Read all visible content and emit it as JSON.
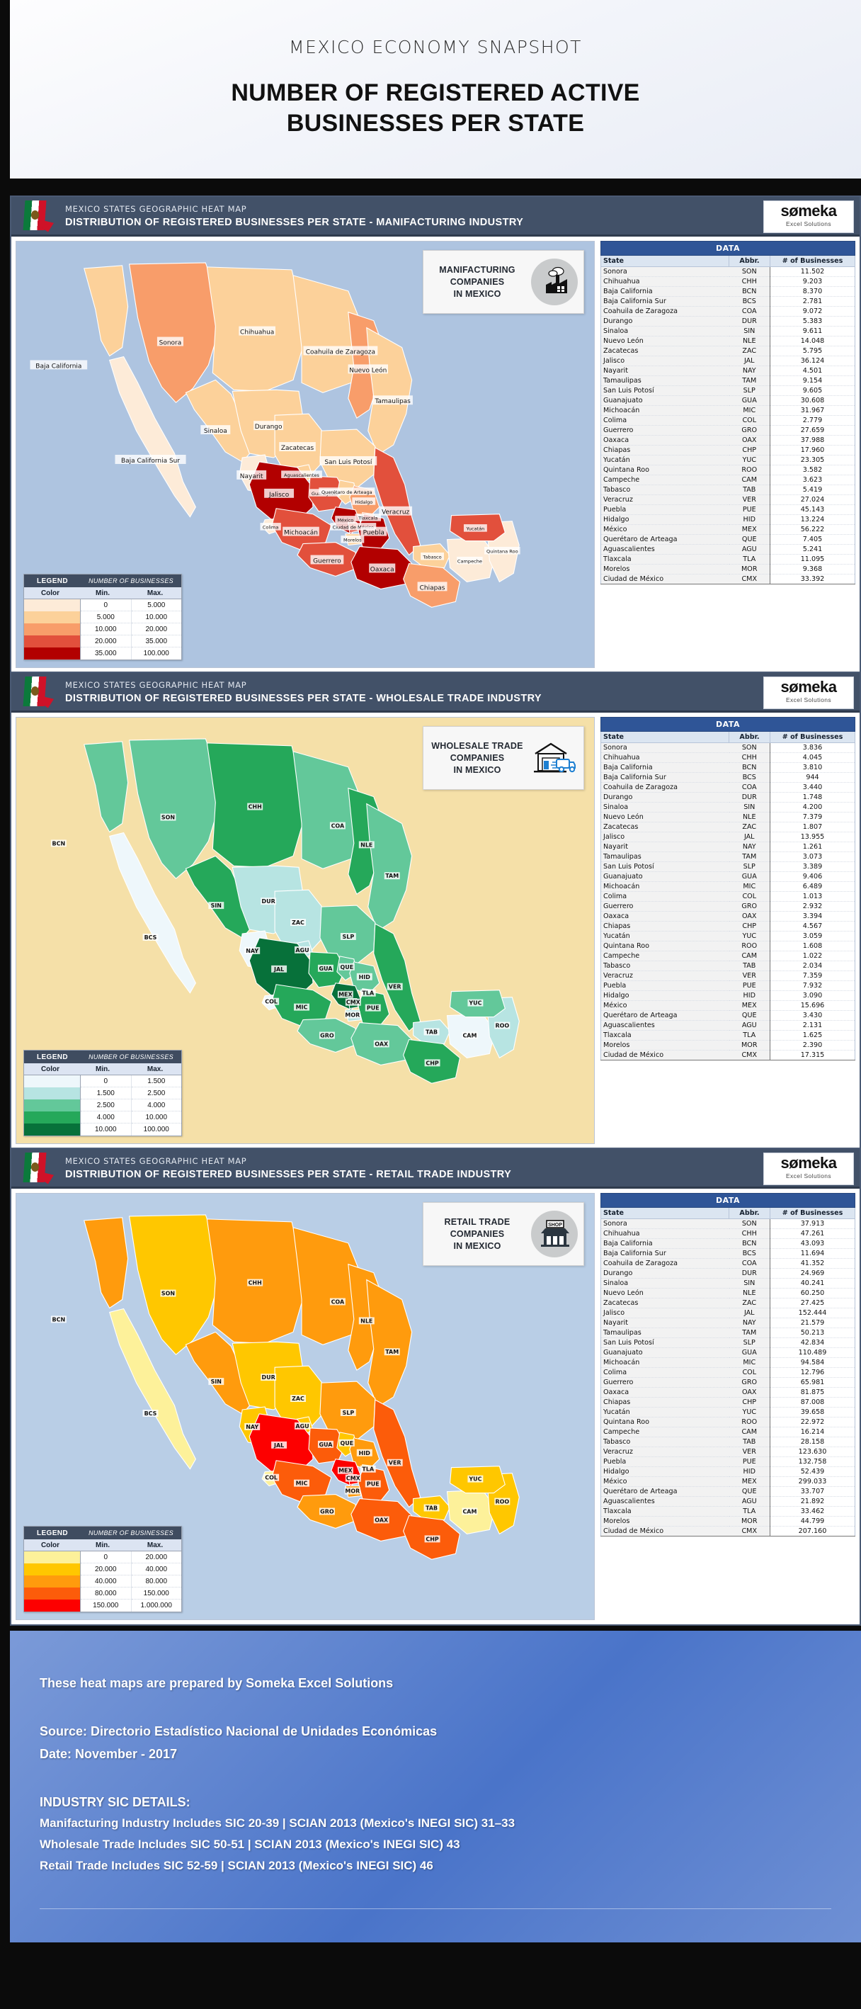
{
  "hero": {
    "subtitle": "MEXICO ECONOMY SNAPSHOT",
    "title_line1": "NUMBER OF REGISTERED ACTIVE",
    "title_line2": "BUSINESSES PER STATE"
  },
  "brand": {
    "name": "sømeka",
    "tagline": "Excel Solutions"
  },
  "table_headers": {
    "banner": "DATA",
    "state": "State",
    "abbr": "Abbr.",
    "number": "# of Businesses"
  },
  "legend_headers": {
    "title": "LEGEND",
    "subtitle": "NUMBER OF BUSINESSES",
    "color": "Color",
    "min": "Min.",
    "max": "Max."
  },
  "panels": [
    {
      "kicker": "MEXICO STATES GEOGRAPHIC HEAT MAP",
      "title": "DISTRIBUTION OF REGISTERED BUSINESSES PER STATE - MANIFACTURING INDUSTRY",
      "map_title": "MANIFACTURING\nCOMPANIES\nIN MEXICO",
      "map_title_lines": [
        "MANIFACTURING",
        "COMPANIES",
        "IN MEXICO"
      ],
      "icon": "factory-icon",
      "sea_color": "#aec4e0",
      "label_mode": "names",
      "legend": [
        {
          "color": "#fdebd8",
          "min": "0",
          "max": "5.000"
        },
        {
          "color": "#fcd19a",
          "min": "5.000",
          "max": "10.000"
        },
        {
          "color": "#f89d6a",
          "min": "10.000",
          "max": "20.000"
        },
        {
          "color": "#e2503c",
          "min": "20.000",
          "max": "35.000"
        },
        {
          "color": "#b20000",
          "min": "35.000",
          "max": "100.000"
        }
      ],
      "rows": [
        {
          "state": "Sonora",
          "abbr": "SON",
          "value": "11.502",
          "n": 11502
        },
        {
          "state": "Chihuahua",
          "abbr": "CHH",
          "value": "9.203",
          "n": 9203
        },
        {
          "state": "Baja California",
          "abbr": "BCN",
          "value": "8.370",
          "n": 8370
        },
        {
          "state": "Baja California Sur",
          "abbr": "BCS",
          "value": "2.781",
          "n": 2781
        },
        {
          "state": "Coahuila de Zaragoza",
          "abbr": "COA",
          "value": "9.072",
          "n": 9072
        },
        {
          "state": "Durango",
          "abbr": "DUR",
          "value": "5.383",
          "n": 5383
        },
        {
          "state": "Sinaloa",
          "abbr": "SIN",
          "value": "9.611",
          "n": 9611
        },
        {
          "state": "Nuevo León",
          "abbr": "NLE",
          "value": "14.048",
          "n": 14048
        },
        {
          "state": "Zacatecas",
          "abbr": "ZAC",
          "value": "5.795",
          "n": 5795
        },
        {
          "state": "Jalisco",
          "abbr": "JAL",
          "value": "36.124",
          "n": 36124
        },
        {
          "state": "Nayarit",
          "abbr": "NAY",
          "value": "4.501",
          "n": 4501
        },
        {
          "state": "Tamaulipas",
          "abbr": "TAM",
          "value": "9.154",
          "n": 9154
        },
        {
          "state": "San Luis Potosí",
          "abbr": "SLP",
          "value": "9.605",
          "n": 9605
        },
        {
          "state": "Guanajuato",
          "abbr": "GUA",
          "value": "30.608",
          "n": 30608
        },
        {
          "state": "Michoacán",
          "abbr": "MIC",
          "value": "31.967",
          "n": 31967
        },
        {
          "state": "Colima",
          "abbr": "COL",
          "value": "2.779",
          "n": 2779
        },
        {
          "state": "Guerrero",
          "abbr": "GRO",
          "value": "27.659",
          "n": 27659
        },
        {
          "state": "Oaxaca",
          "abbr": "OAX",
          "value": "37.988",
          "n": 37988
        },
        {
          "state": "Chiapas",
          "abbr": "CHP",
          "value": "17.960",
          "n": 17960
        },
        {
          "state": "Yucatán",
          "abbr": "YUC",
          "value": "23.305",
          "n": 23305
        },
        {
          "state": "Quintana Roo",
          "abbr": "ROO",
          "value": "3.582",
          "n": 3582
        },
        {
          "state": "Campeche",
          "abbr": "CAM",
          "value": "3.623",
          "n": 3623
        },
        {
          "state": "Tabasco",
          "abbr": "TAB",
          "value": "5.419",
          "n": 5419
        },
        {
          "state": "Veracruz",
          "abbr": "VER",
          "value": "27.024",
          "n": 27024
        },
        {
          "state": "Puebla",
          "abbr": "PUE",
          "value": "45.143",
          "n": 45143
        },
        {
          "state": "Hidalgo",
          "abbr": "HID",
          "value": "13.224",
          "n": 13224
        },
        {
          "state": "México",
          "abbr": "MEX",
          "value": "56.222",
          "n": 56222
        },
        {
          "state": "Querétaro de Arteaga",
          "abbr": "QUE",
          "value": "7.405",
          "n": 7405
        },
        {
          "state": "Aguascalientes",
          "abbr": "AGU",
          "value": "5.241",
          "n": 5241
        },
        {
          "state": "Tlaxcala",
          "abbr": "TLA",
          "value": "11.095",
          "n": 11095
        },
        {
          "state": "Morelos",
          "abbr": "MOR",
          "value": "9.368",
          "n": 9368
        },
        {
          "state": "Ciudad de México",
          "abbr": "CMX",
          "value": "33.392",
          "n": 33392
        }
      ]
    },
    {
      "kicker": "MEXICO STATES GEOGRAPHIC HEAT MAP",
      "title": "DISTRIBUTION OF REGISTERED BUSINESSES PER STATE - WHOLESALE TRADE INDUSTRY",
      "map_title_lines": [
        "WHOLESALE TRADE",
        "COMPANIES",
        "IN MEXICO"
      ],
      "icon": "warehouse-truck-icon",
      "sea_color": "#f5e0a8",
      "label_mode": "abbr",
      "legend": [
        {
          "color": "#eef7fb",
          "min": "0",
          "max": "1.500"
        },
        {
          "color": "#b7e4e2",
          "min": "1.500",
          "max": "2.500"
        },
        {
          "color": "#63c89a",
          "min": "2.500",
          "max": "4.000"
        },
        {
          "color": "#25a85a",
          "min": "4.000",
          "max": "10.000"
        },
        {
          "color": "#07713a",
          "min": "10.000",
          "max": "100.000"
        }
      ],
      "rows": [
        {
          "state": "Sonora",
          "abbr": "SON",
          "value": "3.836",
          "n": 3836
        },
        {
          "state": "Chihuahua",
          "abbr": "CHH",
          "value": "4.045",
          "n": 4045
        },
        {
          "state": "Baja California",
          "abbr": "BCN",
          "value": "3.810",
          "n": 3810
        },
        {
          "state": "Baja California Sur",
          "abbr": "BCS",
          "value": "944",
          "n": 944
        },
        {
          "state": "Coahuila de Zaragoza",
          "abbr": "COA",
          "value": "3.440",
          "n": 3440
        },
        {
          "state": "Durango",
          "abbr": "DUR",
          "value": "1.748",
          "n": 1748
        },
        {
          "state": "Sinaloa",
          "abbr": "SIN",
          "value": "4.200",
          "n": 4200
        },
        {
          "state": "Nuevo León",
          "abbr": "NLE",
          "value": "7.379",
          "n": 7379
        },
        {
          "state": "Zacatecas",
          "abbr": "ZAC",
          "value": "1.807",
          "n": 1807
        },
        {
          "state": "Jalisco",
          "abbr": "JAL",
          "value": "13.955",
          "n": 13955
        },
        {
          "state": "Nayarit",
          "abbr": "NAY",
          "value": "1.261",
          "n": 1261
        },
        {
          "state": "Tamaulipas",
          "abbr": "TAM",
          "value": "3.073",
          "n": 3073
        },
        {
          "state": "San Luis Potosí",
          "abbr": "SLP",
          "value": "3.389",
          "n": 3389
        },
        {
          "state": "Guanajuato",
          "abbr": "GUA",
          "value": "9.406",
          "n": 9406
        },
        {
          "state": "Michoacán",
          "abbr": "MIC",
          "value": "6.489",
          "n": 6489
        },
        {
          "state": "Colima",
          "abbr": "COL",
          "value": "1.013",
          "n": 1013
        },
        {
          "state": "Guerrero",
          "abbr": "GRO",
          "value": "2.932",
          "n": 2932
        },
        {
          "state": "Oaxaca",
          "abbr": "OAX",
          "value": "3.394",
          "n": 3394
        },
        {
          "state": "Chiapas",
          "abbr": "CHP",
          "value": "4.567",
          "n": 4567
        },
        {
          "state": "Yucatán",
          "abbr": "YUC",
          "value": "3.059",
          "n": 3059
        },
        {
          "state": "Quintana Roo",
          "abbr": "ROO",
          "value": "1.608",
          "n": 1608
        },
        {
          "state": "Campeche",
          "abbr": "CAM",
          "value": "1.022",
          "n": 1022
        },
        {
          "state": "Tabasco",
          "abbr": "TAB",
          "value": "2.034",
          "n": 2034
        },
        {
          "state": "Veracruz",
          "abbr": "VER",
          "value": "7.359",
          "n": 7359
        },
        {
          "state": "Puebla",
          "abbr": "PUE",
          "value": "7.932",
          "n": 7932
        },
        {
          "state": "Hidalgo",
          "abbr": "HID",
          "value": "3.090",
          "n": 3090
        },
        {
          "state": "México",
          "abbr": "MEX",
          "value": "15.696",
          "n": 15696
        },
        {
          "state": "Querétaro de Arteaga",
          "abbr": "QUE",
          "value": "3.430",
          "n": 3430
        },
        {
          "state": "Aguascalientes",
          "abbr": "AGU",
          "value": "2.131",
          "n": 2131
        },
        {
          "state": "Tlaxcala",
          "abbr": "TLA",
          "value": "1.625",
          "n": 1625
        },
        {
          "state": "Morelos",
          "abbr": "MOR",
          "value": "2.390",
          "n": 2390
        },
        {
          "state": "Ciudad de México",
          "abbr": "CMX",
          "value": "17.315",
          "n": 17315
        }
      ]
    },
    {
      "kicker": "MEXICO STATES GEOGRAPHIC HEAT MAP",
      "title": "DISTRIBUTION OF REGISTERED BUSINESSES PER STATE - RETAIL TRADE INDUSTRY",
      "map_title_lines": [
        "RETAIL TRADE",
        "COMPANIES",
        "IN MEXICO"
      ],
      "icon": "shop-icon",
      "sea_color": "#b9cee6",
      "label_mode": "abbr",
      "legend": [
        {
          "color": "#fdf19a",
          "min": "0",
          "max": "20.000"
        },
        {
          "color": "#ffc700",
          "min": "20.000",
          "max": "40.000"
        },
        {
          "color": "#ff9b0d",
          "min": "40.000",
          "max": "80.000"
        },
        {
          "color": "#fc5c0a",
          "min": "80.000",
          "max": "150.000"
        },
        {
          "color": "#fd0000",
          "min": "150.000",
          "max": "1.000.000"
        }
      ],
      "rows": [
        {
          "state": "Sonora",
          "abbr": "SON",
          "value": "37.913",
          "n": 37913
        },
        {
          "state": "Chihuahua",
          "abbr": "CHH",
          "value": "47.261",
          "n": 47261
        },
        {
          "state": "Baja California",
          "abbr": "BCN",
          "value": "43.093",
          "n": 43093
        },
        {
          "state": "Baja California Sur",
          "abbr": "BCS",
          "value": "11.694",
          "n": 11694
        },
        {
          "state": "Coahuila de Zaragoza",
          "abbr": "COA",
          "value": "41.352",
          "n": 41352
        },
        {
          "state": "Durango",
          "abbr": "DUR",
          "value": "24.969",
          "n": 24969
        },
        {
          "state": "Sinaloa",
          "abbr": "SIN",
          "value": "40.241",
          "n": 40241
        },
        {
          "state": "Nuevo León",
          "abbr": "NLE",
          "value": "60.250",
          "n": 60250
        },
        {
          "state": "Zacatecas",
          "abbr": "ZAC",
          "value": "27.425",
          "n": 27425
        },
        {
          "state": "Jalisco",
          "abbr": "JAL",
          "value": "152.444",
          "n": 152444
        },
        {
          "state": "Nayarit",
          "abbr": "NAY",
          "value": "21.579",
          "n": 21579
        },
        {
          "state": "Tamaulipas",
          "abbr": "TAM",
          "value": "50.213",
          "n": 50213
        },
        {
          "state": "San Luis Potosí",
          "abbr": "SLP",
          "value": "42.834",
          "n": 42834
        },
        {
          "state": "Guanajuato",
          "abbr": "GUA",
          "value": "110.489",
          "n": 110489
        },
        {
          "state": "Michoacán",
          "abbr": "MIC",
          "value": "94.584",
          "n": 94584
        },
        {
          "state": "Colima",
          "abbr": "COL",
          "value": "12.796",
          "n": 12796
        },
        {
          "state": "Guerrero",
          "abbr": "GRO",
          "value": "65.981",
          "n": 65981
        },
        {
          "state": "Oaxaca",
          "abbr": "OAX",
          "value": "81.875",
          "n": 81875
        },
        {
          "state": "Chiapas",
          "abbr": "CHP",
          "value": "87.008",
          "n": 87008
        },
        {
          "state": "Yucatán",
          "abbr": "YUC",
          "value": "39.658",
          "n": 39658
        },
        {
          "state": "Quintana Roo",
          "abbr": "ROO",
          "value": "22.972",
          "n": 22972
        },
        {
          "state": "Campeche",
          "abbr": "CAM",
          "value": "16.214",
          "n": 16214
        },
        {
          "state": "Tabasco",
          "abbr": "TAB",
          "value": "28.158",
          "n": 28158
        },
        {
          "state": "Veracruz",
          "abbr": "VER",
          "value": "123.630",
          "n": 123630
        },
        {
          "state": "Puebla",
          "abbr": "PUE",
          "value": "132.758",
          "n": 132758
        },
        {
          "state": "Hidalgo",
          "abbr": "HID",
          "value": "52.439",
          "n": 52439
        },
        {
          "state": "México",
          "abbr": "MEX",
          "value": "299.033",
          "n": 299033
        },
        {
          "state": "Querétaro de Arteaga",
          "abbr": "QUE",
          "value": "33.707",
          "n": 33707
        },
        {
          "state": "Aguascalientes",
          "abbr": "AGU",
          "value": "21.892",
          "n": 21892
        },
        {
          "state": "Tlaxcala",
          "abbr": "TLA",
          "value": "33.462",
          "n": 33462
        },
        {
          "state": "Morelos",
          "abbr": "MOR",
          "value": "44.799",
          "n": 44799
        },
        {
          "state": "Ciudad de México",
          "abbr": "CMX",
          "value": "207.160",
          "n": 207160
        }
      ]
    }
  ],
  "footer": {
    "line1": "These heat maps are prepared by Someka Excel Solutions",
    "source": "Source: Directorio Estadístico Nacional de Unidades Económicas",
    "date": "Date: November - 2017",
    "sic_heading": "INDUSTRY SIC DETAILS:",
    "sic1": "Manifacturing Industry Includes SIC 20-39 | SCIAN 2013 (Mexico's INEGI SIC) 31–33",
    "sic2": "Wholesale Trade Includes SIC 50-51 | SCIAN 2013 (Mexico's INEGI SIC) 43",
    "sic3": "Retail Trade Includes SIC 52-59 | SCIAN 2013 (Mexico's INEGI SIC) 46"
  },
  "chart_data": {
    "type": "heatmap",
    "title": "NUMBER OF REGISTERED ACTIVE BUSINESSES PER STATE",
    "subtitle": "MEXICO ECONOMY SNAPSHOT",
    "maps": [
      {
        "name": "Manifacturing Industry",
        "unit": "# of Businesses",
        "bins": [
          0,
          5000,
          10000,
          20000,
          35000,
          100000
        ]
      },
      {
        "name": "Wholesale Trade Industry",
        "unit": "# of Businesses",
        "bins": [
          0,
          1500,
          2500,
          4000,
          10000,
          100000
        ]
      },
      {
        "name": "Retail Trade Industry",
        "unit": "# of Businesses",
        "bins": [
          0,
          20000,
          40000,
          80000,
          150000,
          1000000
        ]
      }
    ]
  }
}
